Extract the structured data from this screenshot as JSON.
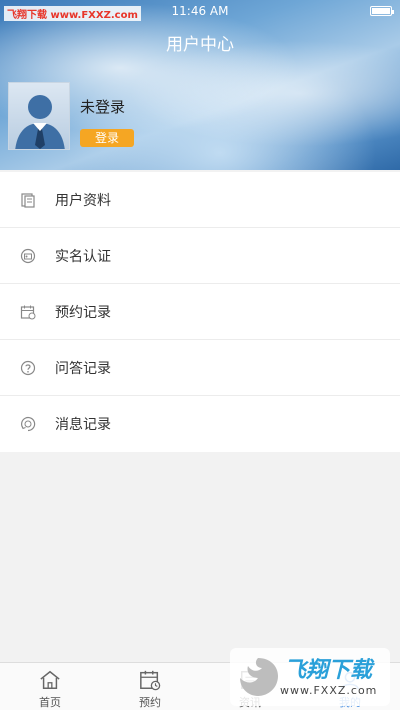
{
  "watermark": "飞翔下载 www.FXXZ.com",
  "status_bar": {
    "time": "11:46 AM"
  },
  "header": {
    "title": "用户中心"
  },
  "profile": {
    "username": "未登录",
    "login_label": "登录"
  },
  "menu": {
    "items": [
      {
        "label": "用户资料",
        "icon": "document-icon"
      },
      {
        "label": "实名认证",
        "icon": "id-card-icon"
      },
      {
        "label": "预约记录",
        "icon": "calendar-icon"
      },
      {
        "label": "问答记录",
        "icon": "question-icon"
      },
      {
        "label": "消息记录",
        "icon": "message-icon"
      }
    ]
  },
  "tabbar": {
    "tabs": [
      {
        "label": "首页",
        "icon": "home-icon"
      },
      {
        "label": "预约",
        "icon": "calendar-clock-icon"
      },
      {
        "label": "资讯",
        "icon": "news-icon"
      },
      {
        "label": "我的",
        "icon": "user-icon",
        "active": true
      }
    ]
  },
  "logo": {
    "text": "飞翔下载",
    "url": "www.FXXZ.com"
  },
  "colors": {
    "accent": "#4a90e2",
    "login_button": "#f5a623"
  }
}
